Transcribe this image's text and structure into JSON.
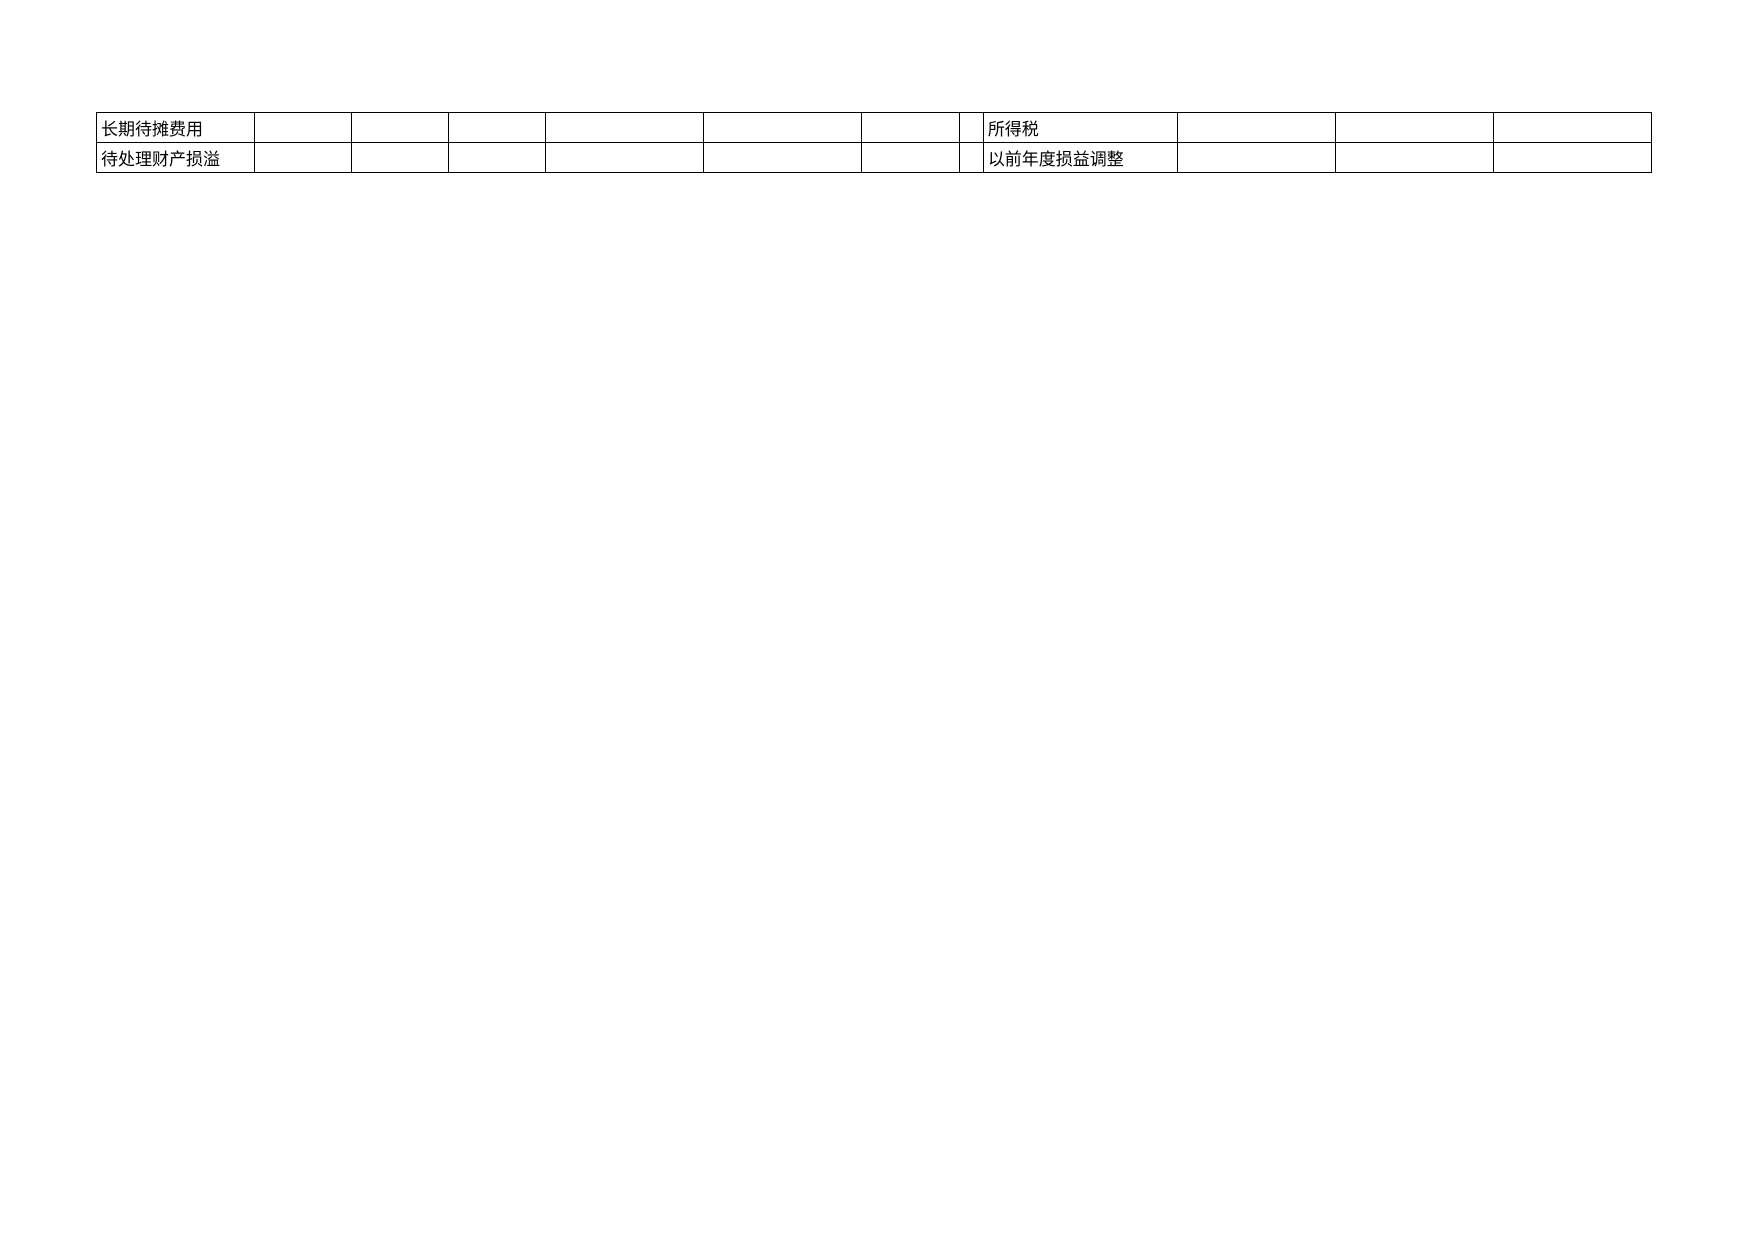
{
  "rows": [
    {
      "left_label": "长期待摊费用",
      "c1": "",
      "c2": "",
      "c3": "",
      "c4": "",
      "c5": "",
      "c6": "",
      "c7": "",
      "right_label": "所得税",
      "c9": "",
      "c10": "",
      "c11": ""
    },
    {
      "left_label": "待处理财产损溢",
      "c1": "",
      "c2": "",
      "c3": "",
      "c4": "",
      "c5": "",
      "c6": "",
      "c7": "",
      "right_label": "以前年度损益调整",
      "c9": "",
      "c10": "",
      "c11": ""
    }
  ]
}
